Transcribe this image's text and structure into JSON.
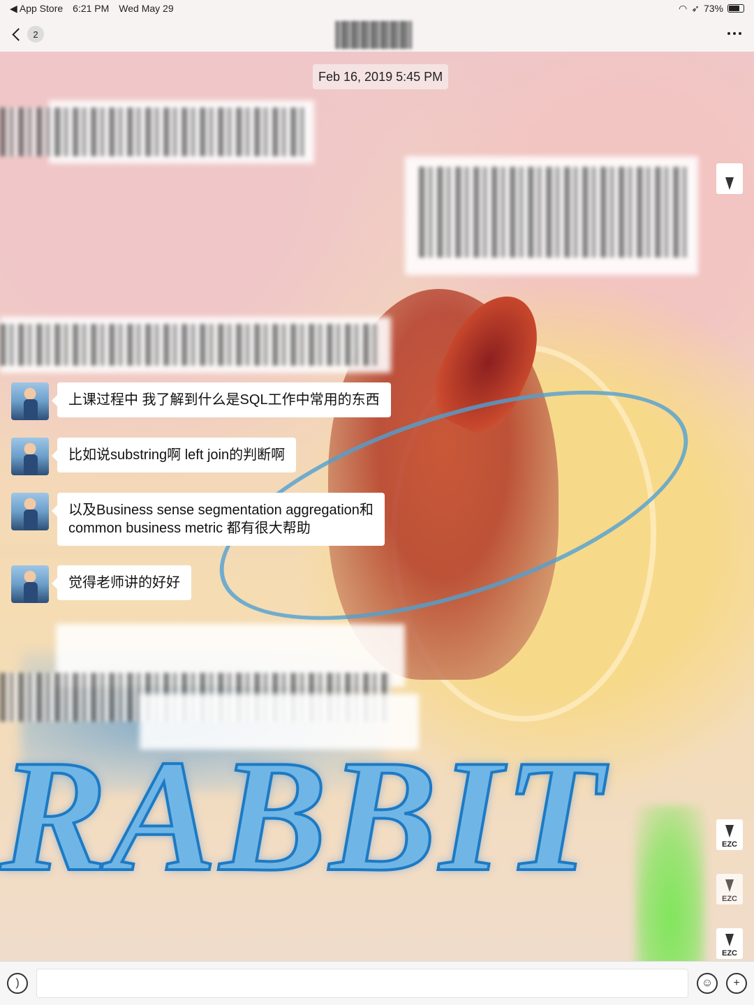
{
  "status_bar": {
    "back_app": "◀ App Store",
    "time": "6:21 PM",
    "date": "Wed May 29",
    "battery": "73%"
  },
  "nav": {
    "unread_count": "2"
  },
  "chat": {
    "timestamp": "Feb 16, 2019 5:45 PM",
    "wallpaper_text": "RABBIT",
    "messages": [
      {
        "text": "上课过程中 我了解到什么是SQL工作中常用的东西"
      },
      {
        "text": "比如说substring啊 left join的判断啊"
      },
      {
        "text": "以及Business sense segmentation aggregation和"
      },
      {
        "text": "common business metric 都有很大帮助"
      },
      {
        "text": "觉得老师讲的好好"
      }
    ],
    "peer_avatar_label": "EZC"
  },
  "input_bar": {
    "placeholder": ""
  }
}
